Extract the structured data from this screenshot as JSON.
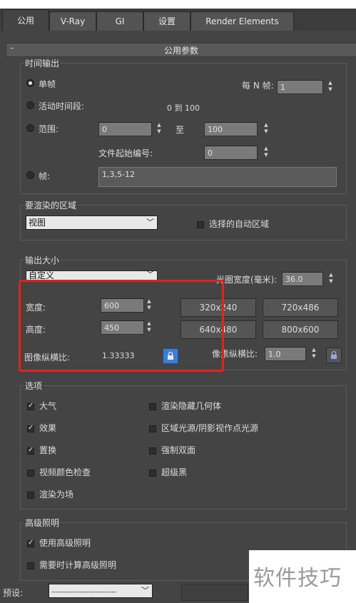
{
  "tabs": [
    {
      "label": "公用",
      "active": true
    },
    {
      "label": "V-Ray"
    },
    {
      "label": "GI"
    },
    {
      "label": "设置"
    },
    {
      "label": "Render Elements"
    }
  ],
  "rollout": {
    "collapse": "-",
    "title": "公用参数"
  },
  "time_output": {
    "legend": "时间输出",
    "single": "单帧",
    "every_n_label": "每 N 帧:",
    "every_n_value": "1",
    "active_segment": "活动时间段:",
    "active_range": "0 到 100",
    "range": "范围:",
    "range_from": "0",
    "range_to_label": "至",
    "range_to": "100",
    "file_start_label": "文件起始编号:",
    "file_start_value": "0",
    "frames": "帧:",
    "frames_value": "1,3,5-12"
  },
  "render_area": {
    "legend": "要渲染的区域",
    "dropdown": "视图",
    "auto_region": "选择的自动区域"
  },
  "output_size": {
    "legend": "输出大小",
    "preset": "自定义",
    "aperture_label": "光圈宽度(毫米):",
    "aperture_value": "36.0",
    "width_label": "宽度:",
    "width_value": "600",
    "height_label": "高度:",
    "height_value": "450",
    "image_aspect_label": "图像纵横比:",
    "image_aspect_value": "1.33333",
    "pixel_aspect_label": "像素纵横比:",
    "pixel_aspect_value": "1.0",
    "presets": [
      "320x240",
      "720x486",
      "640x480",
      "800x600"
    ]
  },
  "options": {
    "legend": "选项",
    "left": [
      {
        "label": "大气",
        "checked": true
      },
      {
        "label": "效果",
        "checked": true
      },
      {
        "label": "置换",
        "checked": true
      },
      {
        "label": "视频颜色检查",
        "checked": false
      },
      {
        "label": "渲染为场",
        "checked": false
      }
    ],
    "right": [
      {
        "label": "渲染隐藏几何体",
        "checked": false
      },
      {
        "label": "区域光源/阴影视作点光源",
        "checked": false
      },
      {
        "label": "强制双面",
        "checked": false
      },
      {
        "label": "超级黑",
        "checked": false
      }
    ]
  },
  "advanced_lighting": {
    "legend": "高级照明",
    "use": "使用高级照明",
    "compute": "需要时计算高级照明"
  },
  "bottom": {
    "preset_label": "预设:",
    "preset_value": "----------------------------"
  },
  "watermark": "软件技巧"
}
